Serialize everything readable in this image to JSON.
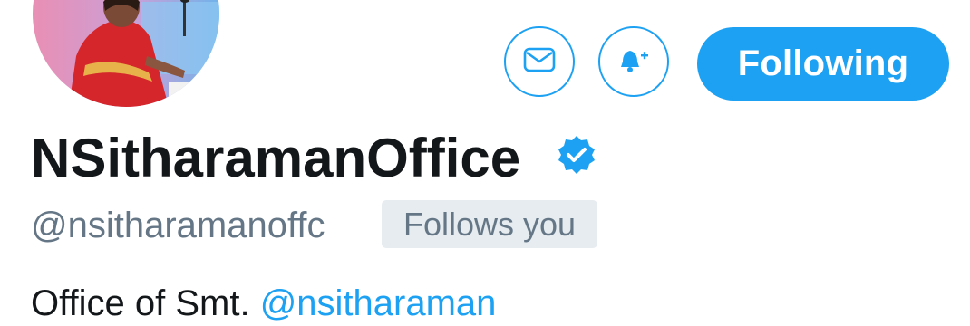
{
  "profile": {
    "display_name": "NSitharamanOffice",
    "verified": true,
    "handle": "@nsitharamanoffc",
    "follows_you_label": "Follows you",
    "bio_prefix": "Office of Smt. ",
    "bio_mention": "@nsitharaman"
  },
  "actions": {
    "message_icon": "envelope-icon",
    "notify_icon": "bell-plus-icon",
    "following_label": "Following"
  },
  "colors": {
    "accent": "#1da1f2",
    "primary_text": "#14171a",
    "secondary_text": "#657786",
    "badge_bg": "#e6ecf0"
  }
}
